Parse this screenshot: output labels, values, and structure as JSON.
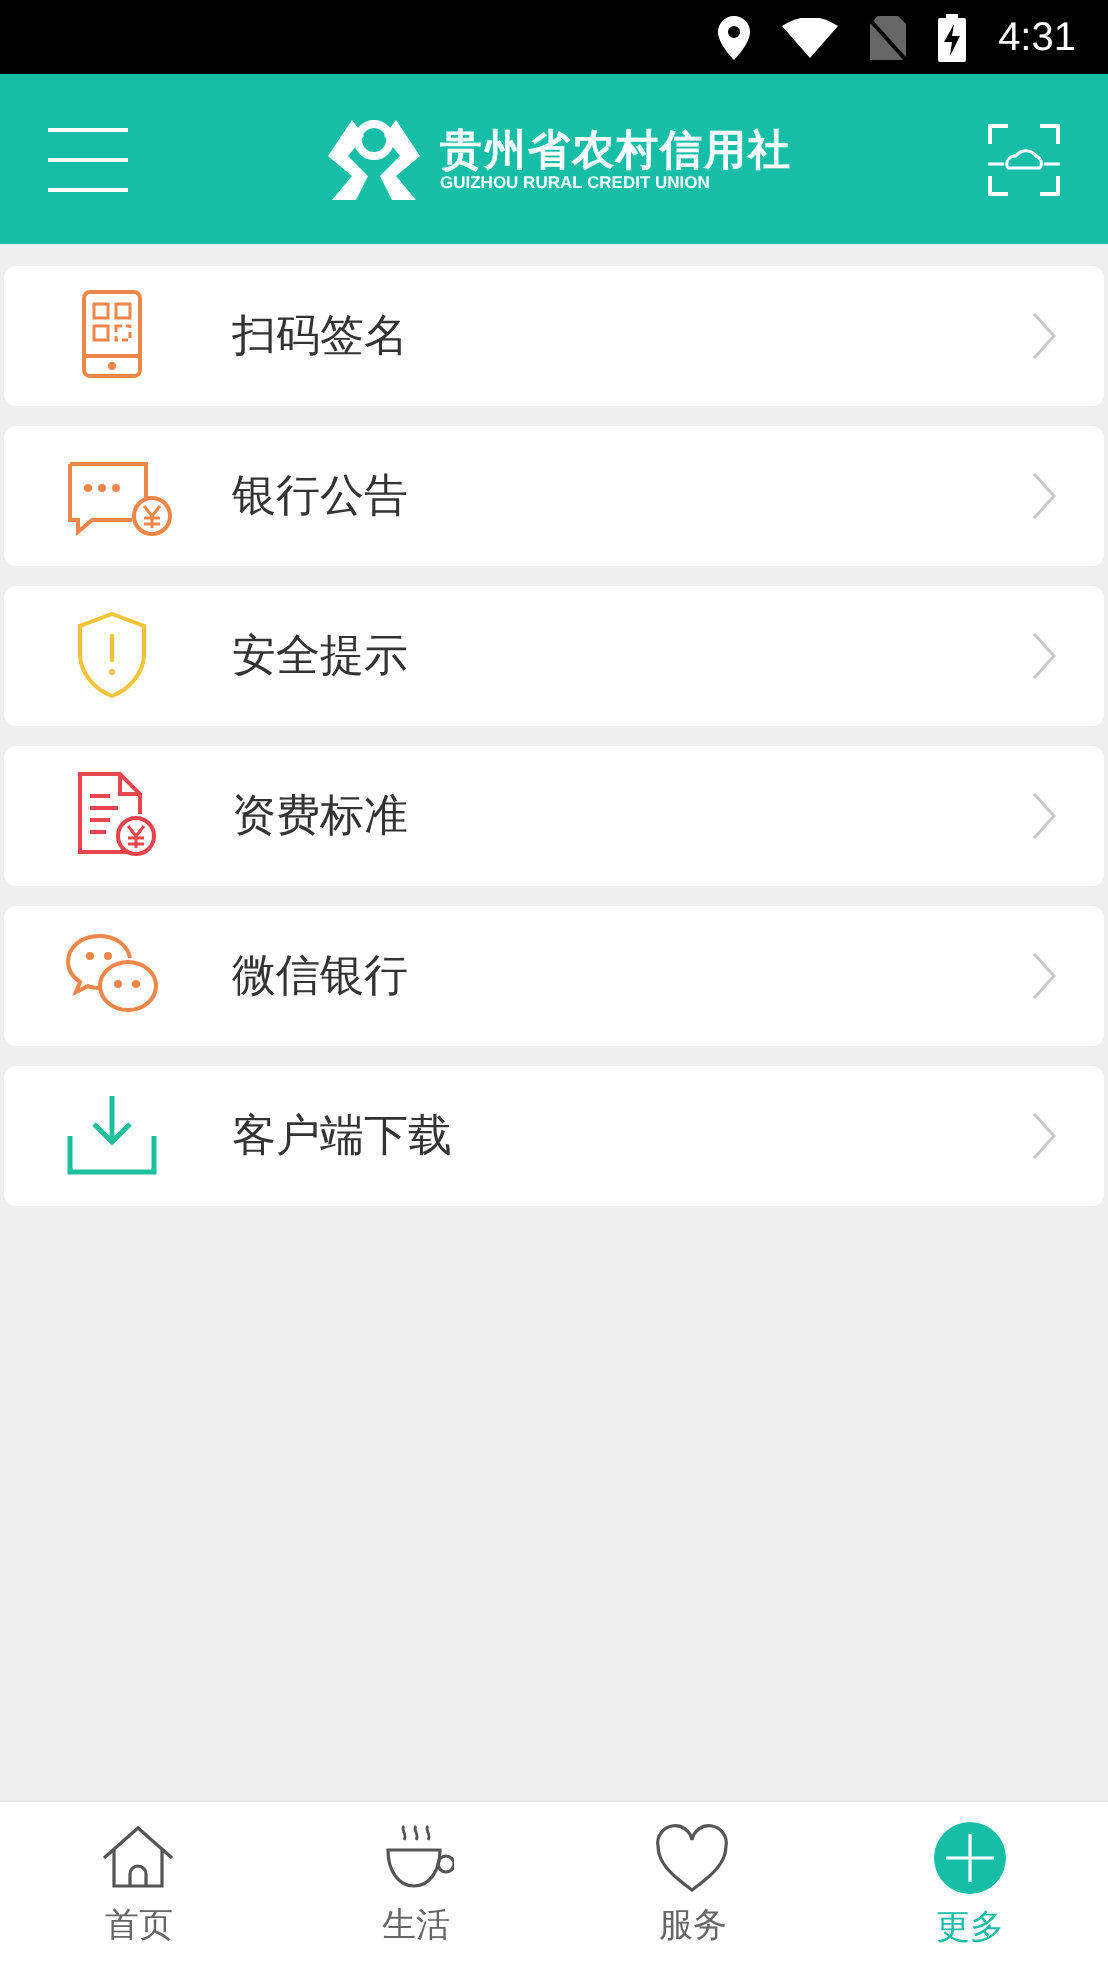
{
  "status_bar": {
    "time": "4:31"
  },
  "header": {
    "logo_title": "贵州省农村信用社",
    "logo_subtitle": "GUIZHOU RURAL CREDIT UNION"
  },
  "menu_items": [
    {
      "kind": "qr-tablet",
      "label": "扫码签名"
    },
    {
      "kind": "chat-yen",
      "label": "银行公告"
    },
    {
      "kind": "shield",
      "label": "安全提示"
    },
    {
      "kind": "doc-yen",
      "label": "资费标准"
    },
    {
      "kind": "chat-bubbles",
      "label": "微信银行"
    },
    {
      "kind": "download",
      "label": "客户端下载"
    }
  ],
  "tab_bar": [
    {
      "kind": "home",
      "label": "首页",
      "selected": false
    },
    {
      "kind": "cup",
      "label": "生活",
      "selected": false
    },
    {
      "kind": "heart",
      "label": "服务",
      "selected": false
    },
    {
      "kind": "plus",
      "label": "更多",
      "selected": true
    }
  ]
}
